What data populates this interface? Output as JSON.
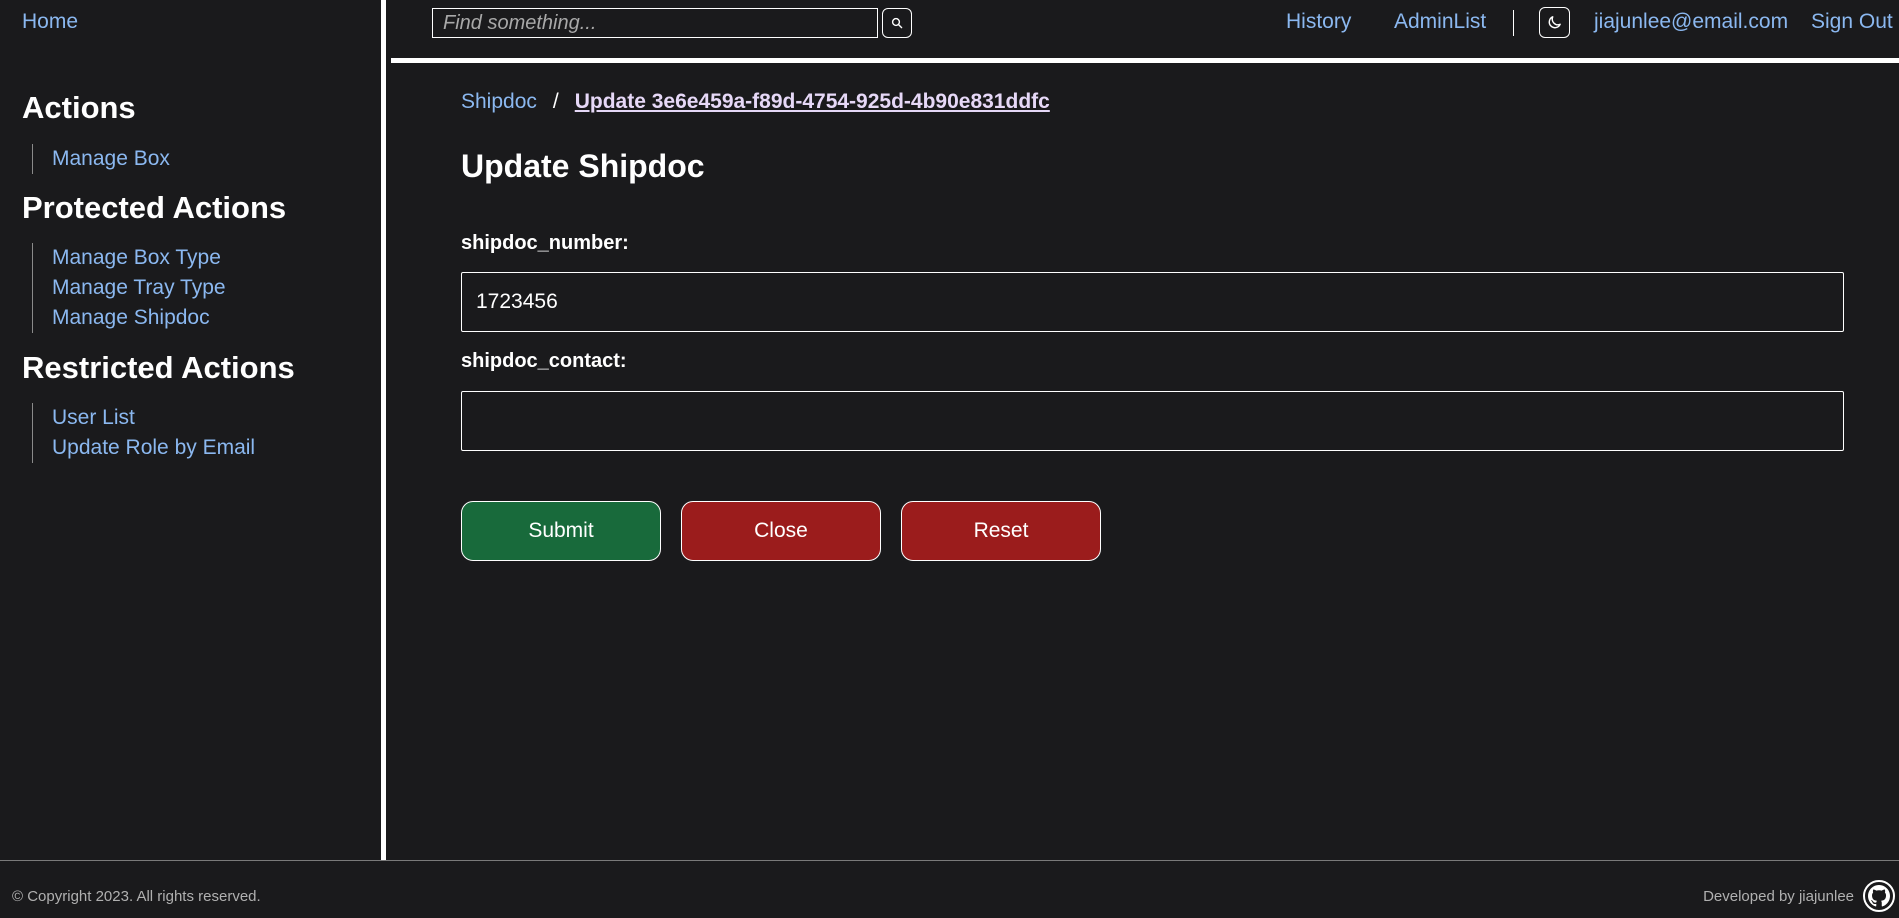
{
  "sidebar": {
    "home": "Home",
    "sections": [
      {
        "title": "Actions",
        "items": [
          "Manage Box"
        ]
      },
      {
        "title": "Protected Actions",
        "items": [
          "Manage Box Type",
          "Manage Tray Type",
          "Manage Shipdoc"
        ]
      },
      {
        "title": "Restricted Actions",
        "items": [
          "User List",
          "Update Role by Email"
        ]
      }
    ]
  },
  "header": {
    "search_placeholder": "Find something...",
    "history": "History",
    "admin_list": "AdminList",
    "user_email": "jiajunlee@email.com",
    "sign_out": "Sign Out"
  },
  "breadcrumb": {
    "parent": "Shipdoc",
    "separator": "/",
    "current": "Update 3e6e459a-f89d-4754-925d-4b90e831ddfc"
  },
  "page_title": "Update Shipdoc",
  "form": {
    "fields": [
      {
        "label": "shipdoc_number:",
        "value": "1723456"
      },
      {
        "label": "shipdoc_contact:",
        "value": ""
      }
    ],
    "submit": "Submit",
    "close": "Close",
    "reset": "Reset"
  },
  "footer": {
    "copyright": "© Copyright 2023. All rights reserved.",
    "developer": "Developed by jiajunlee"
  },
  "colors": {
    "background": "#1a1a1c",
    "link": "#8bb8f0",
    "submit": "#186a3b",
    "danger": "#9b1c1c"
  },
  "icons": [
    "search-icon",
    "moon-icon",
    "github-icon"
  ]
}
